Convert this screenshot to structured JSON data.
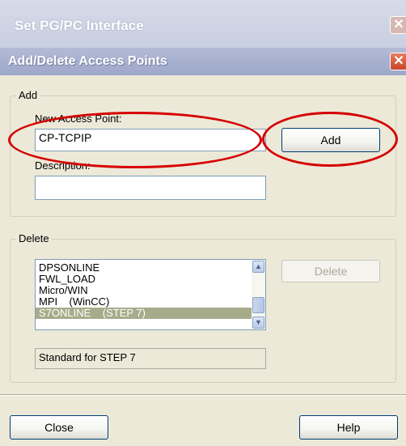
{
  "background_window": {
    "title": "Set PG/PC Interface",
    "close_symbol": "✕"
  },
  "dialog": {
    "title": "Add/Delete Access Points",
    "close_symbol": "✕",
    "add_group": {
      "label": "Add",
      "new_access_point_label": "New Access Point:",
      "new_access_point_value": "CP-TCPIP",
      "description_label": "Description:",
      "description_value": "",
      "add_button": "Add"
    },
    "delete_group": {
      "label": "Delete",
      "access_points": [
        "DPSONLINE",
        "FWL_LOAD",
        "Micro/WIN",
        "MPI    (WinCC)",
        "S7ONLINE    (STEP 7)"
      ],
      "selected_index": 4,
      "delete_button": "Delete",
      "status_text": "Standard for STEP 7",
      "scroll_up_icon": "▲",
      "scroll_down_icon": "▼"
    },
    "close_button": "Close",
    "help_button": "Help"
  },
  "annotation_color": "#d60000"
}
